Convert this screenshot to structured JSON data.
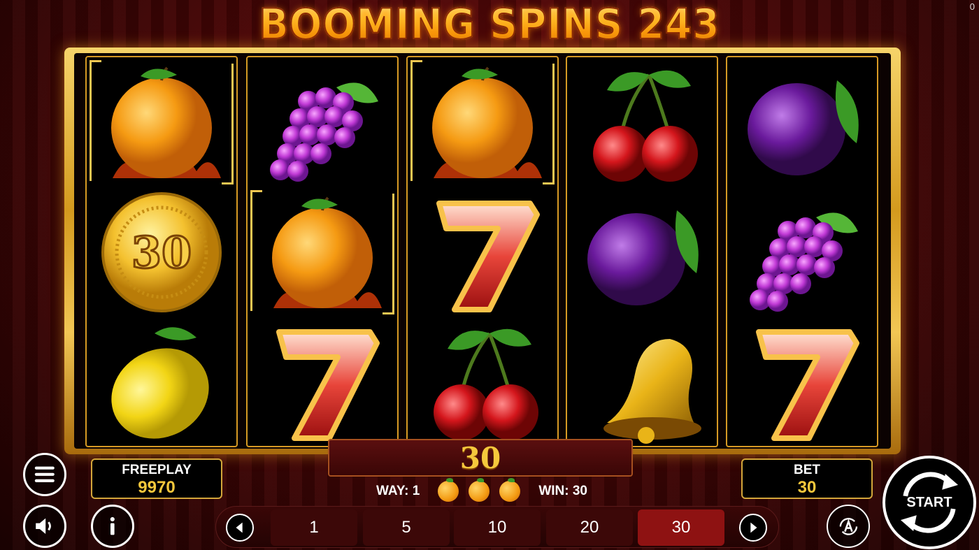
{
  "corner_counter": "0",
  "game_title": "BOOMING SPINS 243",
  "reels": [
    [
      "orange",
      "coin",
      "lemon"
    ],
    [
      "grapes",
      "orange",
      "seven"
    ],
    [
      "orange",
      "seven",
      "cherry"
    ],
    [
      "cherry",
      "plum",
      "bell"
    ],
    [
      "plum",
      "grapes",
      "seven"
    ]
  ],
  "coin_value": "30",
  "win_display": "30",
  "way_label": "WAY: 1",
  "win_label": "WIN: 30",
  "freeplay": {
    "label": "FREEPLAY",
    "value": "9970"
  },
  "bet": {
    "label": "BET",
    "value": "30"
  },
  "bet_options": [
    "1",
    "5",
    "10",
    "20",
    "30"
  ],
  "selected_bet": "30",
  "start_label": "START",
  "icons": {
    "menu": "hamburger-menu-icon",
    "sound": "speaker-icon",
    "info": "info-icon",
    "autoplay": "autoplay-icon",
    "prev": "arrow-left-icon",
    "next": "arrow-right-icon"
  }
}
